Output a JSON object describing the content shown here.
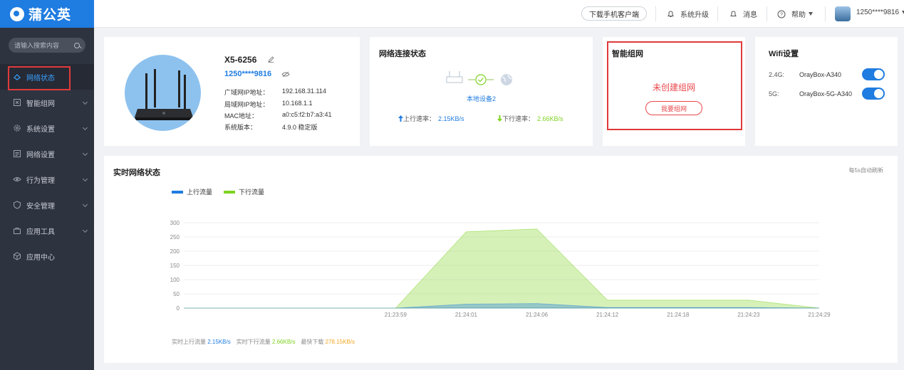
{
  "app": {
    "name": "蒲公英"
  },
  "sidebar": {
    "search_placeholder": "请输入搜索内容",
    "items": [
      {
        "label": "网络状态",
        "icon": "network-status-icon",
        "active": true
      },
      {
        "label": "智能组网",
        "icon": "mesh-icon"
      },
      {
        "label": "系统设置",
        "icon": "gear-icon"
      },
      {
        "label": "网络设置",
        "icon": "network-settings-icon"
      },
      {
        "label": "行为管理",
        "icon": "eye-icon"
      },
      {
        "label": "安全管理",
        "icon": "shield-icon"
      },
      {
        "label": "应用工具",
        "icon": "toolbox-icon"
      },
      {
        "label": "应用中心",
        "icon": "cube-icon"
      }
    ]
  },
  "topbar": {
    "download_app": "下载手机客户端",
    "upgrade": "系统升级",
    "messages": "消息",
    "help": "帮助",
    "user": "1250****9816"
  },
  "device": {
    "name": "X5-6256",
    "sn": "1250****9816",
    "fields": [
      {
        "label": "广域网IP地址：",
        "value": "192.168.31.114"
      },
      {
        "label": "局域网IP地址：",
        "value": "10.168.1.1"
      },
      {
        "label": "MAC地址：",
        "value": "a0:c5:f2:b7:a3:41"
      },
      {
        "label": "系统版本：",
        "value": "4.9.0 稳定版"
      }
    ]
  },
  "net_status": {
    "title": "网络连接状态",
    "local_device": "本地设备2",
    "up_label": "上行速率：",
    "up_value": "2.15KB/s",
    "down_label": "下行速率：",
    "down_value": "2.66KB/s"
  },
  "mesh": {
    "title": "智能组网",
    "status": "未创建组网",
    "button": "我要组网"
  },
  "wifi": {
    "title": "Wifi设置",
    "bands": [
      {
        "band": "2.4G:",
        "ssid": "OrayBox-A340",
        "enabled": true
      },
      {
        "band": "5G:",
        "ssid": "OrayBox-5G-A340",
        "enabled": true
      }
    ]
  },
  "realtime": {
    "title": "实时网络状态",
    "refresh_note": "每5s自动刷新",
    "footer": {
      "up_label": "实时上行流量",
      "up_value": "2.15KB/s",
      "down_label": "实时下行流量",
      "down_value": "2.66KB/s",
      "peak_label": "最快下载",
      "peak_value": "278.15KB/s"
    }
  },
  "colors": {
    "accent": "#1f7ce0",
    "upload": "#1f7ce0",
    "download": "#7ed321",
    "alert": "#e8484d"
  },
  "chart_data": {
    "type": "area",
    "title": "",
    "xlabel": "",
    "ylabel": "",
    "x": [
      "",
      "",
      "",
      "21:23:59",
      "21:24:01",
      "21:24:06",
      "21:24:12",
      "21:24:18",
      "21:24:23",
      "21:24:29"
    ],
    "ylim": [
      0,
      300
    ],
    "yticks": [
      0,
      50,
      100,
      150,
      200,
      250,
      300
    ],
    "series": [
      {
        "name": "上行流量",
        "color": "#1f7ce0",
        "values": [
          0,
          0,
          0,
          0,
          14,
          16,
          2,
          2,
          2,
          0
        ]
      },
      {
        "name": "下行流量",
        "color": "#7ed321",
        "values": [
          0,
          0,
          0,
          0,
          268,
          278,
          28,
          28,
          28,
          0
        ]
      }
    ],
    "legend": "top-left",
    "grid": true
  }
}
